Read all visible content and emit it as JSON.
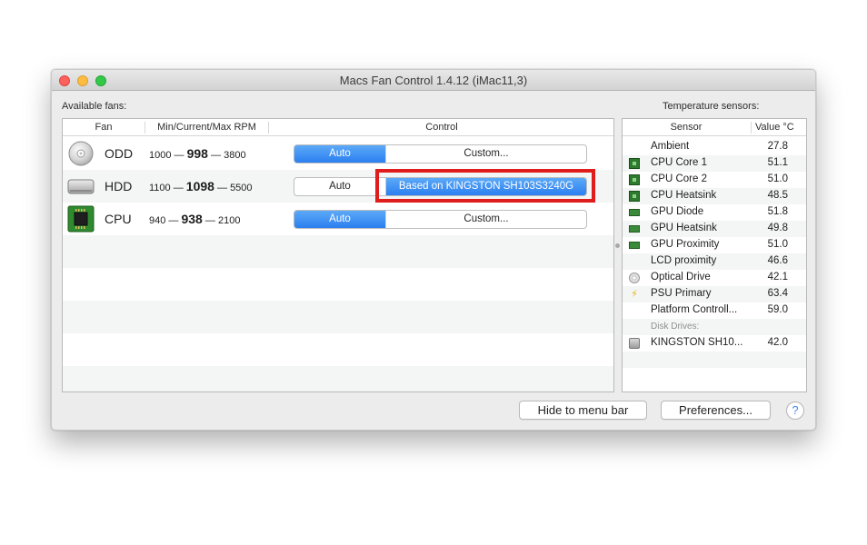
{
  "window": {
    "title": "Macs Fan Control 1.4.12 (iMac11,3)"
  },
  "labels": {
    "available_fans": "Available fans:",
    "temperature_sensors": "Temperature sensors:"
  },
  "fans_table": {
    "headers": {
      "fan": "Fan",
      "rpm": "Min/Current/Max RPM",
      "control": "Control"
    },
    "rows": [
      {
        "name": "ODD",
        "icon": "optical-drive-icon",
        "min": "1000",
        "current": "998",
        "max": "3800",
        "control_left": "Auto",
        "control_right": "Custom...",
        "active": "left"
      },
      {
        "name": "HDD",
        "icon": "hard-drive-icon",
        "min": "1100",
        "current": "1098",
        "max": "5500",
        "control_left": "Auto",
        "control_right": "Based on KINGSTON SH103S3240G",
        "active": "right"
      },
      {
        "name": "CPU",
        "icon": "cpu-chip-icon",
        "min": "940",
        "current": "938",
        "max": "2100",
        "control_left": "Auto",
        "control_right": "Custom...",
        "active": "left"
      }
    ],
    "dash": "—"
  },
  "sensors_table": {
    "headers": {
      "sensor": "Sensor",
      "value": "Value °C"
    },
    "rows": [
      {
        "name": "Ambient",
        "value": "27.8",
        "icon": ""
      },
      {
        "name": "CPU Core 1",
        "value": "51.1",
        "icon": "cpu-chip-icon"
      },
      {
        "name": "CPU Core 2",
        "value": "51.0",
        "icon": "cpu-chip-icon"
      },
      {
        "name": "CPU Heatsink",
        "value": "48.5",
        "icon": "cpu-chip-icon"
      },
      {
        "name": "GPU Diode",
        "value": "51.8",
        "icon": "gpu-card-icon"
      },
      {
        "name": "GPU Heatsink",
        "value": "49.8",
        "icon": "gpu-card-icon"
      },
      {
        "name": "GPU Proximity",
        "value": "51.0",
        "icon": "gpu-card-icon"
      },
      {
        "name": "LCD proximity",
        "value": "46.6",
        "icon": ""
      },
      {
        "name": "Optical Drive",
        "value": "42.1",
        "icon": "optical-drive-icon"
      },
      {
        "name": "PSU Primary",
        "value": "63.4",
        "icon": "power-bolt-icon"
      },
      {
        "name": "Platform Controll...",
        "value": "59.0",
        "icon": ""
      },
      {
        "group": "Disk Drives:"
      },
      {
        "name": "KINGSTON SH10...",
        "value": "42.0",
        "icon": "hard-drive-icon"
      }
    ]
  },
  "buttons": {
    "hide_to_menu_bar": "Hide to menu bar",
    "preferences": "Preferences...",
    "help": "?"
  },
  "colors": {
    "accent": "#2b7ff0",
    "highlight": "#e01d1d"
  }
}
